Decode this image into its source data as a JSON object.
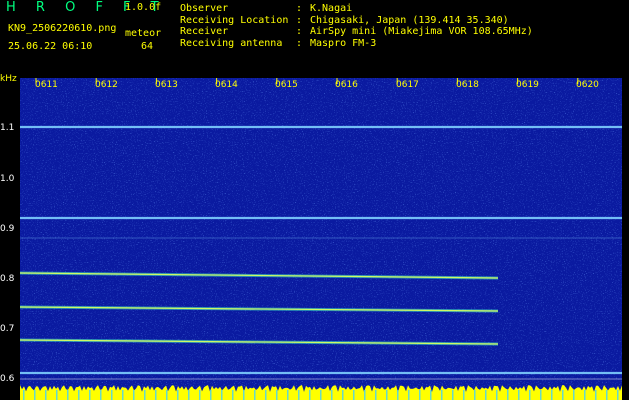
{
  "header": {
    "app_title": "H R O F F T",
    "version": "1.0.0f",
    "filename": "KN9_2506220610.png",
    "mode": "meteor",
    "datetime": "25.06.22 06:10",
    "count": "64",
    "info": [
      {
        "key": "Observer",
        "sep": ":",
        "value": "K.Nagai"
      },
      {
        "key": "Receiving Location",
        "sep": ":",
        "value": "Chigasaki, Japan (139.414 35.340)"
      },
      {
        "key": "Receiver",
        "sep": ":",
        "value": "AirSpy mini (Miakejima VOR 108.65MHz)"
      },
      {
        "key": "Receiving antenna",
        "sep": ":",
        "value": "Maspro FM-3"
      }
    ]
  },
  "y_axis": {
    "unit": "kHz",
    "ticks": [
      "1.1",
      "1.0",
      "0.9",
      "0.8",
      "0.7",
      "0.6"
    ]
  },
  "x_axis": {
    "ticks": [
      "0611",
      "0612",
      "0613",
      "0614",
      "0615",
      "0616",
      "0617",
      "0618",
      "0619",
      "0620"
    ]
  },
  "colors": {
    "background": "#0a1aa0",
    "carrier": "#7fd0ff",
    "trace_core": "#d8ff60",
    "text_yellow": "#ffff00",
    "text_green": "#00ff7f",
    "noise_band": "#ffff00"
  }
}
